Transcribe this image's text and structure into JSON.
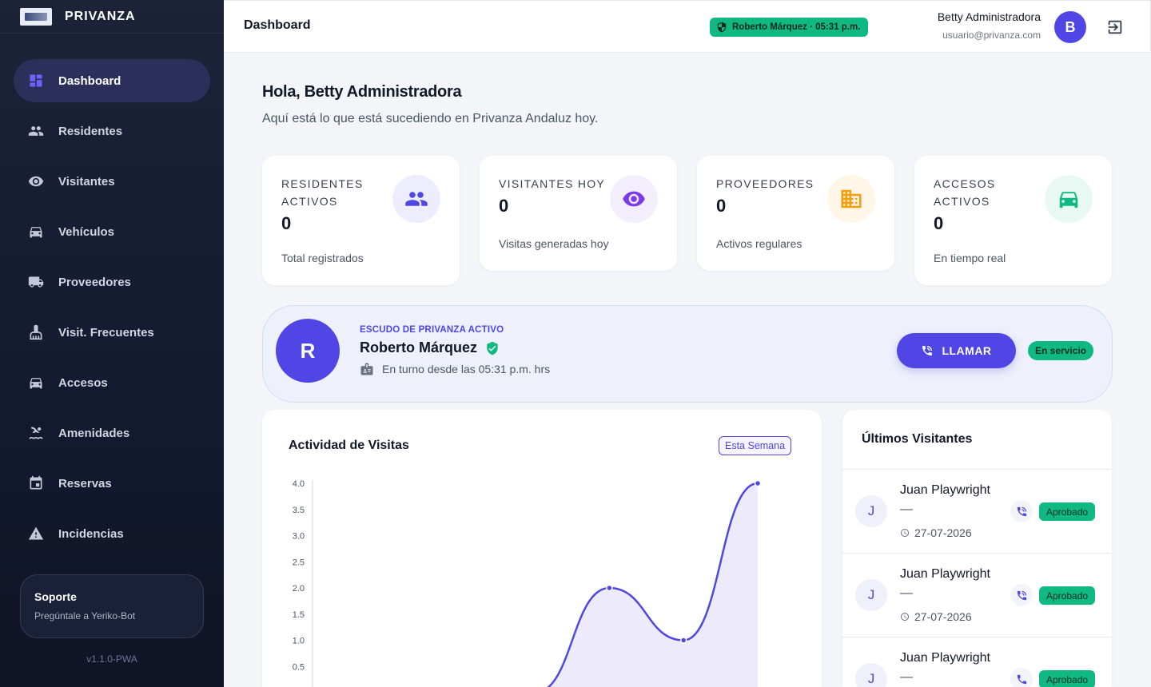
{
  "brand": {
    "name": "PRIVANZA"
  },
  "sidebar": {
    "items": [
      {
        "label": "Dashboard",
        "icon": "dashboard-icon",
        "active": true
      },
      {
        "label": "Residentes",
        "icon": "people-icon"
      },
      {
        "label": "Visitantes",
        "icon": "eye-icon"
      },
      {
        "label": "Vehículos",
        "icon": "car-icon"
      },
      {
        "label": "Proveedores",
        "icon": "truck-icon"
      },
      {
        "label": "Visit. Frecuentes",
        "icon": "cleaning-icon"
      },
      {
        "label": "Accesos",
        "icon": "car-icon"
      },
      {
        "label": "Amenidades",
        "icon": "pool-icon"
      },
      {
        "label": "Reservas",
        "icon": "calendar-icon"
      },
      {
        "label": "Incidencias",
        "icon": "warning-icon"
      }
    ],
    "support": {
      "title": "Soporte",
      "subtitle": "Pregúntale a Yeriko-Bot"
    },
    "version": "v1.1.0-PWA"
  },
  "header": {
    "title": "Dashboard",
    "guard_pill": "Roberto Márquez · 05:31 p.m.",
    "user_name": "Betty Administradora",
    "user_email": "usuario@privanza.com",
    "avatar_letter": "B"
  },
  "greeting": {
    "title": "Hola, Betty Administradora",
    "subtitle": "Aquí está lo que está sucediendo en Privanza Andaluz hoy."
  },
  "stats": [
    {
      "title": "RESIDENTES ACTIVOS",
      "value": "0",
      "note": "Total registrados",
      "icon": "people-icon",
      "color": "#4f46e5",
      "bg": "#eeedfd"
    },
    {
      "title": "VISITANTES HOY",
      "value": "0",
      "note": "Visitas generadas hoy",
      "icon": "eye-icon",
      "color": "#7c3aed",
      "bg": "#f3eefe"
    },
    {
      "title": "PROVEEDORES",
      "value": "0",
      "note": "Activos regulares",
      "icon": "building-icon",
      "color": "#f59e0b",
      "bg": "#fff6e8"
    },
    {
      "title": "ACCESOS ACTIVOS",
      "value": "0",
      "note": "En tiempo real",
      "icon": "car-icon",
      "color": "#10b981",
      "bg": "#e8f8f2"
    }
  ],
  "guard": {
    "avatar_letter": "R",
    "label": "ESCUDO DE PRIVANZA ACTIVO",
    "name": "Roberto Márquez",
    "shift": "En turno desde las 05:31 p.m. hrs",
    "call_label": "LLAMAR",
    "status": "En servicio"
  },
  "activity": {
    "title": "Actividad de Visitas",
    "badge": "Esta Semana"
  },
  "chart_data": {
    "type": "area",
    "title": "Actividad de Visitas",
    "x": [
      0,
      1,
      2,
      3,
      4,
      5,
      6
    ],
    "values": [
      0,
      0,
      0,
      0,
      2,
      1,
      4
    ],
    "yticks": [
      "4.0",
      "3.5",
      "3.0",
      "2.5",
      "2.0",
      "1.5",
      "1.0",
      "0.5"
    ],
    "ylim": [
      0,
      4
    ],
    "color": "#4f46e5",
    "fill": "#eceafb"
  },
  "visitors": {
    "title": "Últimos Visitantes",
    "items": [
      {
        "initial": "J",
        "name": "Juan Playwright",
        "detail": "—",
        "date": "27-07-2026",
        "status": "Aprobado"
      },
      {
        "initial": "J",
        "name": "Juan Playwright",
        "detail": "—",
        "date": "27-07-2026",
        "status": "Aprobado"
      },
      {
        "initial": "J",
        "name": "Juan Playwright",
        "detail": "—",
        "date": "27-07-2026",
        "status": "Aprobado"
      }
    ]
  }
}
